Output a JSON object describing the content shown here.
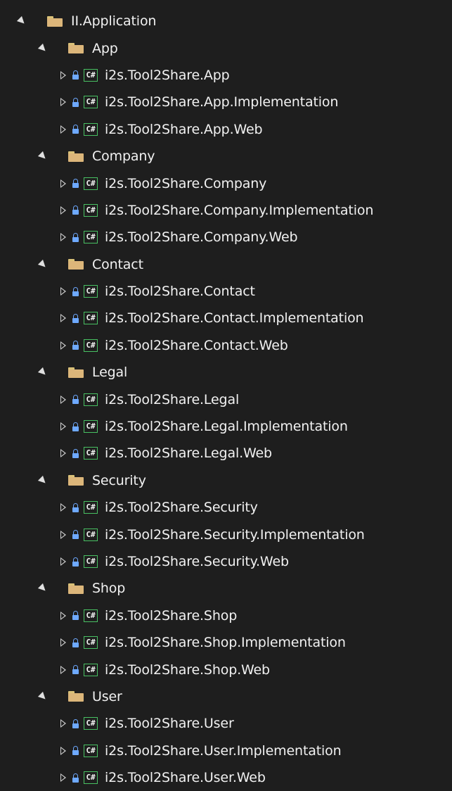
{
  "solution_explorer": {
    "root": {
      "label": "II.Application",
      "folders": [
        {
          "label": "App",
          "projects": [
            "i2s.Tool2Share.App",
            "i2s.Tool2Share.App.Implementation",
            "i2s.Tool2Share.App.Web"
          ]
        },
        {
          "label": "Company",
          "projects": [
            "i2s.Tool2Share.Company",
            "i2s.Tool2Share.Company.Implementation",
            "i2s.Tool2Share.Company.Web"
          ]
        },
        {
          "label": "Contact",
          "projects": [
            "i2s.Tool2Share.Contact",
            "i2s.Tool2Share.Contact.Implementation",
            "i2s.Tool2Share.Contact.Web"
          ]
        },
        {
          "label": "Legal",
          "projects": [
            "i2s.Tool2Share.Legal",
            "i2s.Tool2Share.Legal.Implementation",
            "i2s.Tool2Share.Legal.Web"
          ]
        },
        {
          "label": "Security",
          "projects": [
            "i2s.Tool2Share.Security",
            "i2s.Tool2Share.Security.Implementation",
            "i2s.Tool2Share.Security.Web"
          ]
        },
        {
          "label": "Shop",
          "projects": [
            "i2s.Tool2Share.Shop",
            "i2s.Tool2Share.Shop.Implementation",
            "i2s.Tool2Share.Shop.Web"
          ]
        },
        {
          "label": "User",
          "projects": [
            "i2s.Tool2Share.User",
            "i2s.Tool2Share.User.Implementation",
            "i2s.Tool2Share.User.Web"
          ]
        }
      ]
    },
    "icons": {
      "csharp_glyph": "C#",
      "folder_color": "#dcb67a",
      "lock_color": "#6ea9ff",
      "csharp_border_color": "#48c062"
    },
    "theme": {
      "background": "#1e1e1e",
      "text": "#f1f1f1"
    }
  }
}
